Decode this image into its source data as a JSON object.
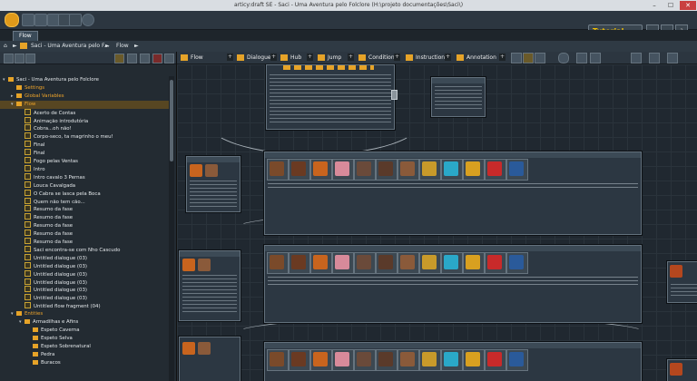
{
  "window": {
    "title": "articy:draft SE - Saci - Uma Aventura pelo Folclore (H:\\projeto documentações\\Saci\\)",
    "minimize": "–",
    "maximize": "☐",
    "close": "✕"
  },
  "toolbar": {
    "tutorial_label": "Tutorial"
  },
  "tabs": {
    "flow_label": "Flow"
  },
  "breadcrumb": {
    "project": "Saci - Uma Aventura pelo F...",
    "separator": "►",
    "current": "Flow"
  },
  "tree": {
    "project": "Saci - Uma Aventura pelo Folclore",
    "settings": "Settings",
    "global_variables": "Global Variables",
    "flow": "Flow",
    "flow_items": [
      "Acerto de Contas",
      "Animação introdutória",
      "Cobra...oh não!",
      "Corpo-seco, ta magrinho o meu!",
      "Final",
      "Final",
      "Fogo pelas Ventas",
      "Intro",
      "Intro cavalo 3 Pernas",
      "Louca Cavalgada",
      "O Cabra se lasca pela Boca",
      "Quem não tem cão...",
      "Resumo da fase",
      "Resumo da fase",
      "Resumo da fase",
      "Resumo da fase",
      "Resumo da fase",
      "Saci encontra-se com Nho Cascudo",
      "Untitled dialogue (03)",
      "Untitled dialogue (03)",
      "Untitled dialogue (03)",
      "Untitled dialogue (03)",
      "Untitled dialogue (03)",
      "Untitled dialogue (03)",
      "Untitled flow fragment (04)"
    ],
    "entities": "Entities",
    "entity_group": "Armadilhas e Afins",
    "entity_items": [
      "Espeto Caverna",
      "Espeto Selva",
      "Espeto Sobrenatural",
      "Pedra",
      "Buracos"
    ]
  },
  "canvas_tools": {
    "flow_fragment": "Flow Fragment",
    "dialogue": "Dialogue",
    "hub": "Hub",
    "jump": "Jump",
    "condition": "Condition",
    "instruction": "Instruction",
    "annotation": "Annotation"
  },
  "colors": {
    "accent": "#e6a328",
    "tutorial": "#f3c000"
  }
}
